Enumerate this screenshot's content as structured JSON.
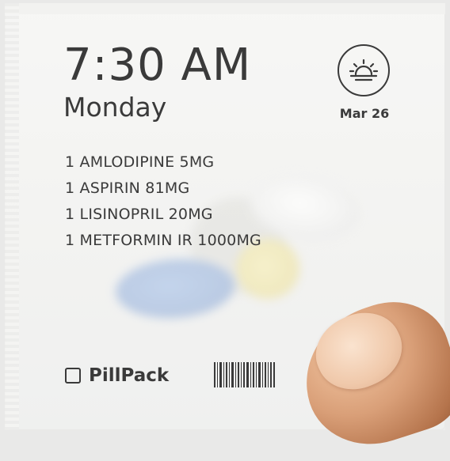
{
  "label": {
    "time": "7:30 AM",
    "day": "Monday",
    "date": "Mar 26",
    "time_of_day_icon": "sunrise-icon",
    "medications": [
      "1 AMLODIPINE 5MG",
      "1 ASPIRIN 81MG",
      "1 LISINOPRIL 20MG",
      "1 METFORMIN IR 1000MG"
    ],
    "brand": {
      "icon": "square-outline-icon",
      "name": "PillPack"
    },
    "barcode_icon": "barcode-icon"
  },
  "colors": {
    "ink": "#3a3a3a",
    "pouch": "#f2f2f1",
    "pill_blue": "#9cb5dc",
    "pill_yellow": "#ebe0a2",
    "skin": "#d99f78"
  }
}
